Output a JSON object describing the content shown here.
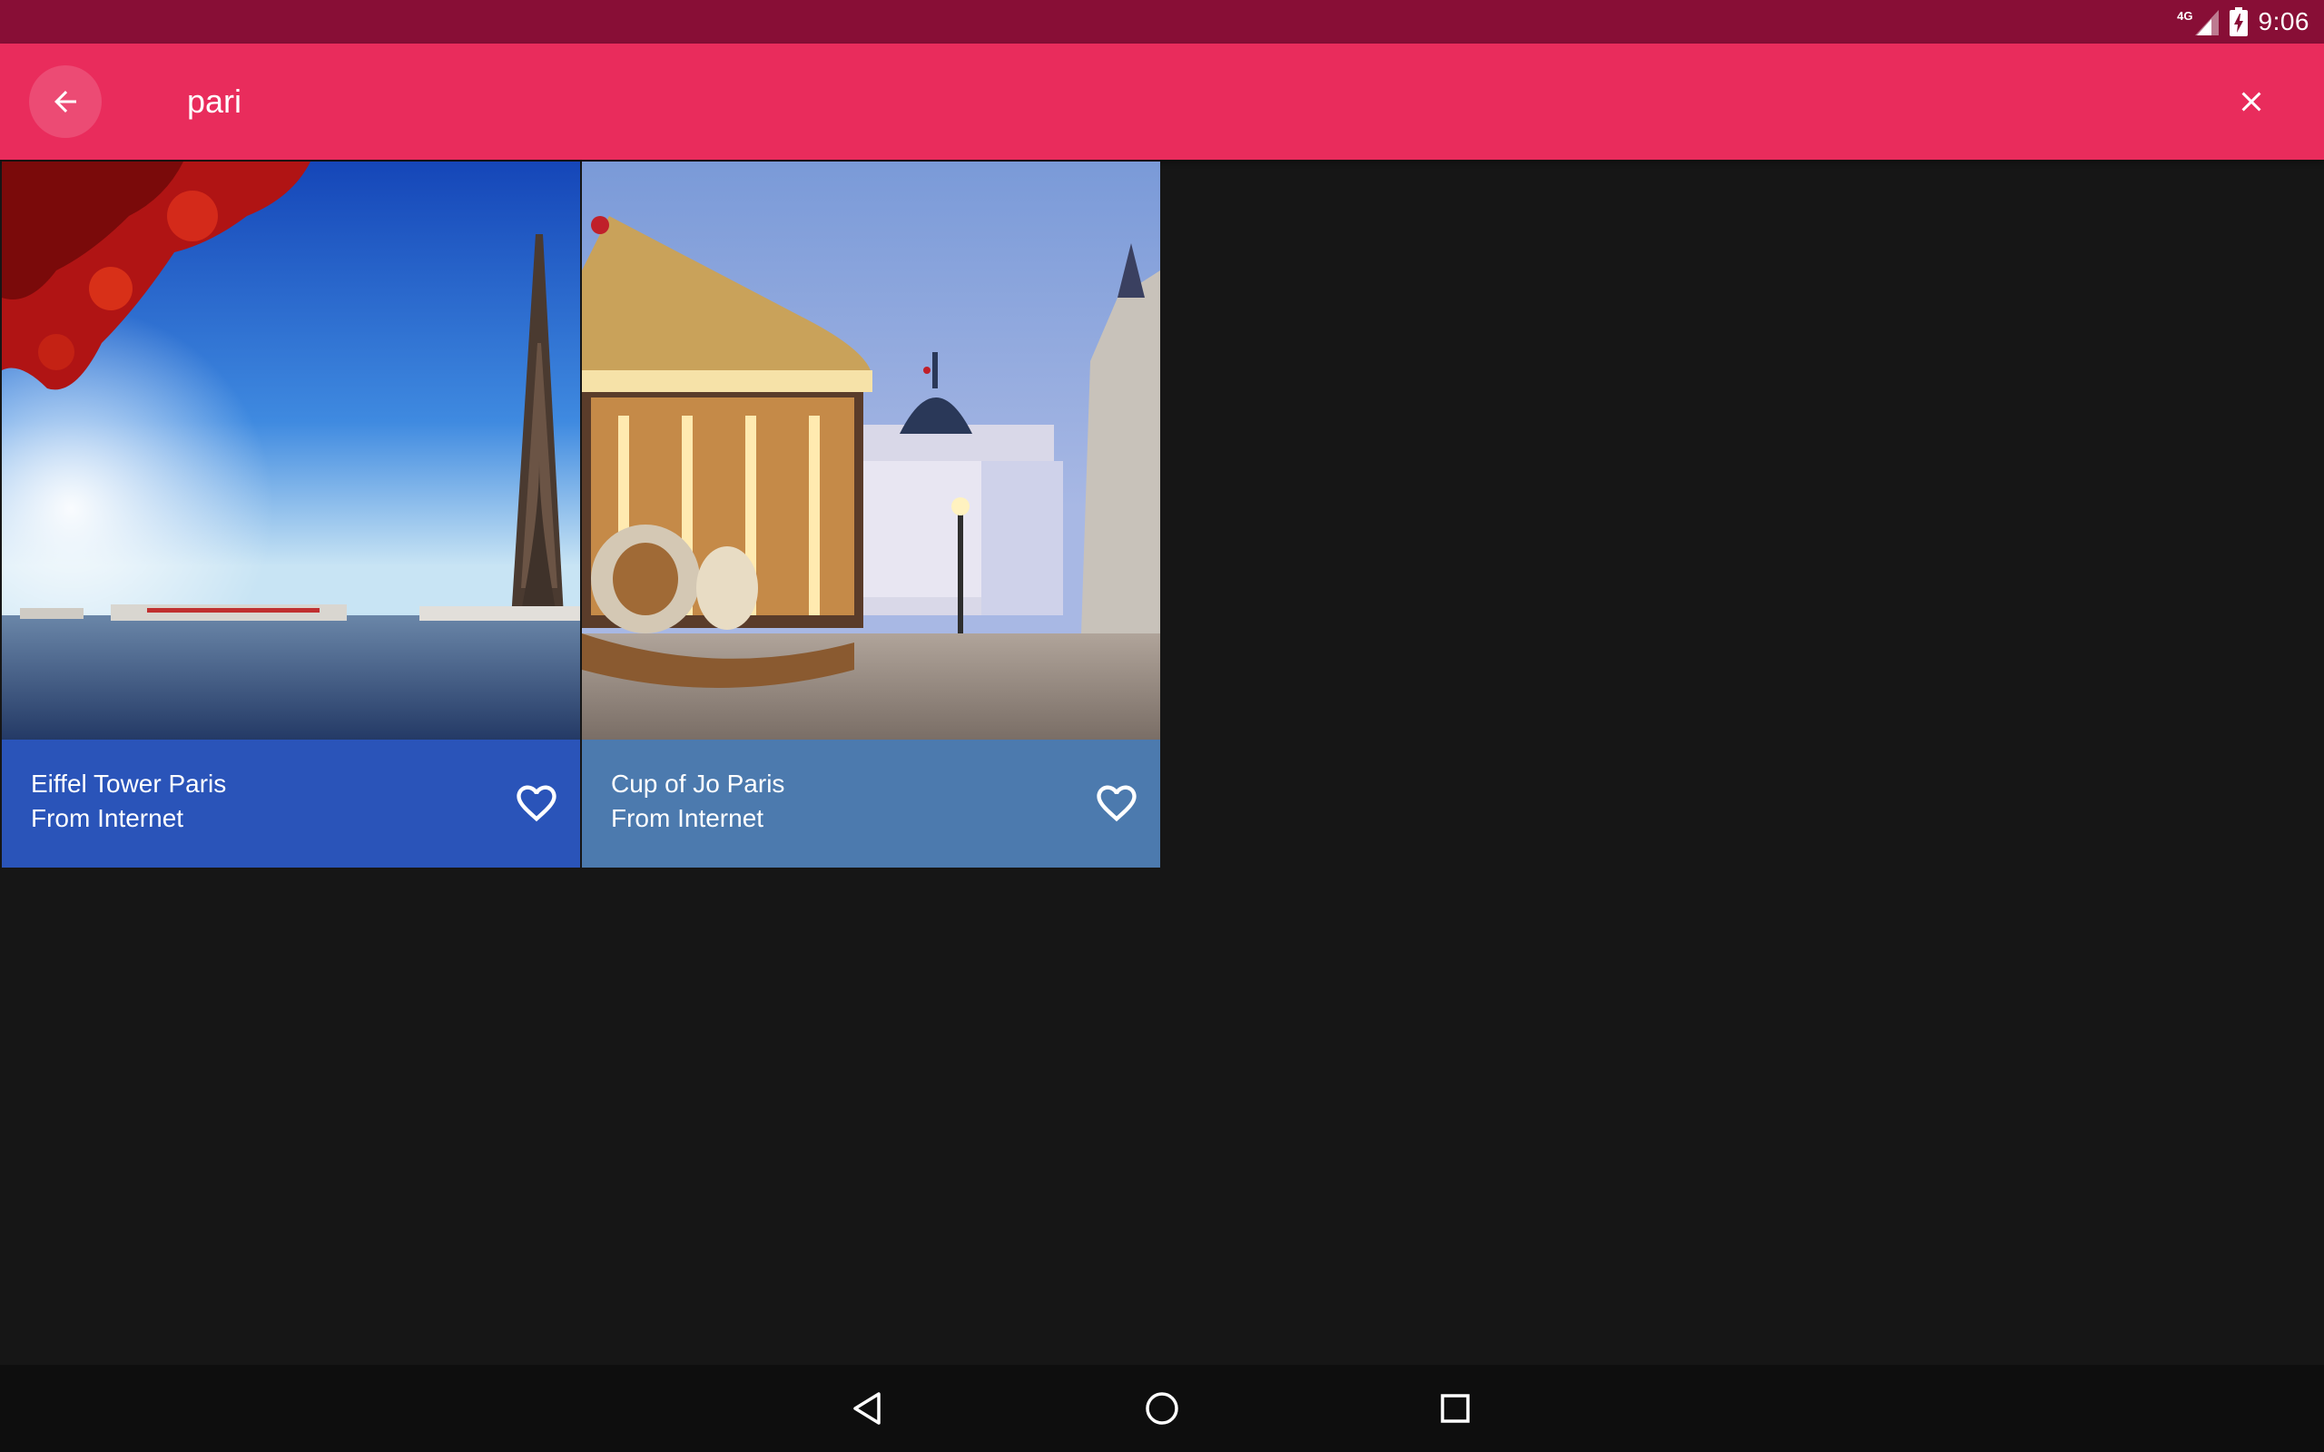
{
  "status_bar": {
    "network_label": "4G",
    "time": "9:06",
    "background": "#880e36"
  },
  "toolbar": {
    "background": "#e92c5c",
    "back_icon": "arrow-back-icon",
    "search_value": "pari",
    "clear_icon": "close-icon"
  },
  "results": [
    {
      "title": "Eiffel Tower Paris",
      "subtitle": "From Internet",
      "footer_color": "#2a54b9",
      "favorite_icon": "heart-outline-icon"
    },
    {
      "title": "Cup of Jo Paris",
      "subtitle": "From Internet",
      "footer_color": "#4c7aae",
      "favorite_icon": "heart-outline-icon"
    }
  ],
  "nav_bar": {
    "back_icon": "nav-back-triangle-icon",
    "home_icon": "nav-home-circle-icon",
    "recents_icon": "nav-recents-square-icon"
  }
}
